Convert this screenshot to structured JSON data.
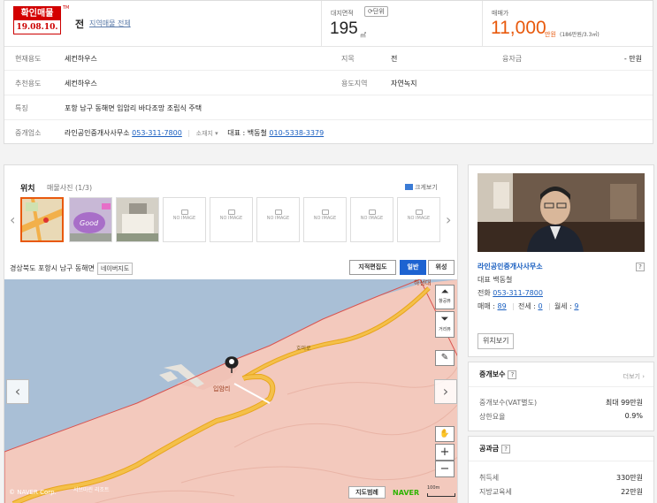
{
  "header": {
    "badge_top": "확인매물",
    "badge_date": "19.08.10.",
    "badge_tm": "TM",
    "land_category": "전",
    "all_items_link": "지역매물 전체",
    "area_label": "대지면적",
    "unit_button": "단위",
    "area_value": "195",
    "area_unit": "㎡",
    "price_label": "매매가",
    "price_value": "11,000",
    "price_unit": "만원",
    "price_sub": "(186만원/3.3㎡)"
  },
  "rows": {
    "current_use_label": "현재용도",
    "current_use_value": "세컨하우스",
    "land_cat_label": "지목",
    "land_cat_value": "전",
    "financing_label": "융자금",
    "financing_value": "- 만원",
    "recommend_label": "추천용도",
    "recommend_value": "세컨하우스",
    "zoning_label": "용도지역",
    "zoning_value": "자연녹지",
    "feature_label": "특징",
    "feature_value": "포항 남구 동해면 입암리 바다조망 조립식 주택",
    "office_label": "중개업소",
    "office_name": "라인공인중개사사무소",
    "office_phone": "053-311-7800",
    "office_location": "소재지",
    "rep_label": "대표 : 백동철",
    "rep_phone": "010-5338-3379"
  },
  "map_panel": {
    "location_title": "위치",
    "photo_label": "매물사진",
    "photo_count": "(1/3)",
    "enlarge": "크게보기",
    "no_image": "NO IMAGE",
    "address": "경상북도 포항시 남구 동해면",
    "nearby_map": "네이버지도",
    "btn_cadastral": "지적편집도",
    "btn_normal": "일반",
    "btn_satellite": "위성",
    "ctl_panorama": "항공뷰",
    "ctl_distance": "거리뷰",
    "legend": "지도범례",
    "naver": "NAVER",
    "scale": "100m",
    "copyright": "© NAVER Corp.",
    "label_village": "입암리",
    "label_road": "호미로",
    "label_hasun": "하선대",
    "label_resort": "서브마린 리조트",
    "photo_good": "Good"
  },
  "agent": {
    "name": "라인공인중개사사무소",
    "rep": "대표 백동철",
    "phone_label": "전화",
    "phone": "053-311-7800",
    "sale_label": "매매",
    "sale_count": "89",
    "jeonse_label": "전세",
    "jeonse_count": "0",
    "monthly_label": "월세",
    "monthly_count": "9",
    "locate_button": "위치보기"
  },
  "fee": {
    "title": "중개보수",
    "more": "더보기",
    "vat_label": "중개보수(VAT별도)",
    "vat_value": "최대 99만원",
    "rate_label": "상한요율",
    "rate_value": "0.9%"
  },
  "tax": {
    "title": "공과금",
    "acq_label": "취득세",
    "acq_value": "330만원",
    "edu_label": "지방교육세",
    "edu_value": "22만원"
  },
  "colors": {
    "price": "#e8590c",
    "link": "#1a5fc0",
    "map_land": "#f3c9bd",
    "map_sea": "#a9bfd6",
    "road": "#f0b428",
    "active_button": "#1d63d1"
  }
}
